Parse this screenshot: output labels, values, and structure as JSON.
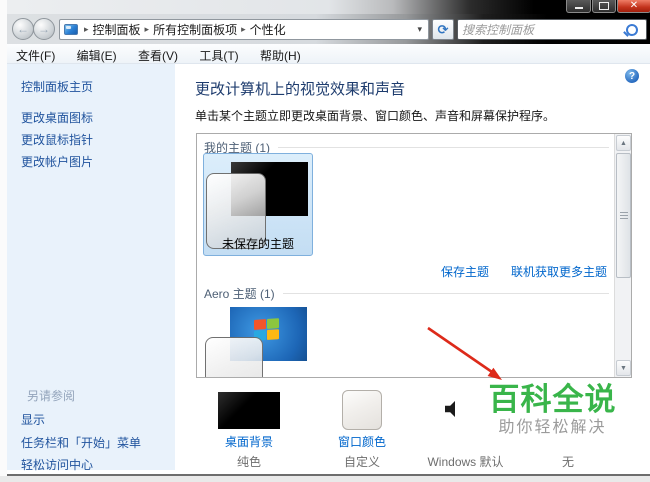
{
  "window": {
    "breadcrumb": {
      "separator": "▸",
      "items": [
        "控制面板",
        "所有控制面板项",
        "个性化"
      ],
      "dropdown": "▾"
    },
    "search": {
      "placeholder": "搜索控制面板"
    },
    "icons": {
      "back": "←",
      "forward": "→",
      "refresh": "⟳",
      "close": "✕",
      "help": "?",
      "scroll_up": "▲",
      "scroll_down": "▼",
      "search": "magnifier-icon",
      "personalization": "personalization-icon"
    }
  },
  "menubar": {
    "items": [
      "文件(F)",
      "编辑(E)",
      "查看(V)",
      "工具(T)",
      "帮助(H)"
    ]
  },
  "sidebar": {
    "home": "控制面板主页",
    "tasks": [
      "更改桌面图标",
      "更改鼠标指针",
      "更改帐户图片"
    ],
    "see_also_header": "另请参阅",
    "see_also_items": [
      "显示",
      "任务栏和「开始」菜单",
      "轻松访问中心"
    ]
  },
  "main": {
    "title": "更改计算机上的视觉效果和声音",
    "subtitle": "单击某个主题立即更改桌面背景、窗口颜色、声音和屏幕保护程序。",
    "my_themes_header": "我的主题 (1)",
    "unsaved_theme_label": "未保存的主题",
    "save_theme_link": "保存主题",
    "get_more_themes_link": "联机获取更多主题",
    "aero_themes_header": "Aero 主题 (1)",
    "bottom_items": [
      {
        "label": "桌面背景",
        "value": "纯色"
      },
      {
        "label": "窗口颜色",
        "value": "自定义"
      },
      {
        "label": "",
        "value": "Windows 默认"
      },
      {
        "label": "",
        "value": "无"
      }
    ]
  },
  "watermark": {
    "title": "百科全说",
    "subtitle": "助你轻松解决"
  },
  "colors": {
    "link_blue": "#0066cc",
    "header_navy": "#1e3c6e",
    "sidebar_blue": "#e9f2fb",
    "selection_blue": "#cde4f7",
    "watermark_green": "#39b54a",
    "annotation_arrow_red": "#dd2a1a",
    "close_button_red": "#c3331c"
  }
}
